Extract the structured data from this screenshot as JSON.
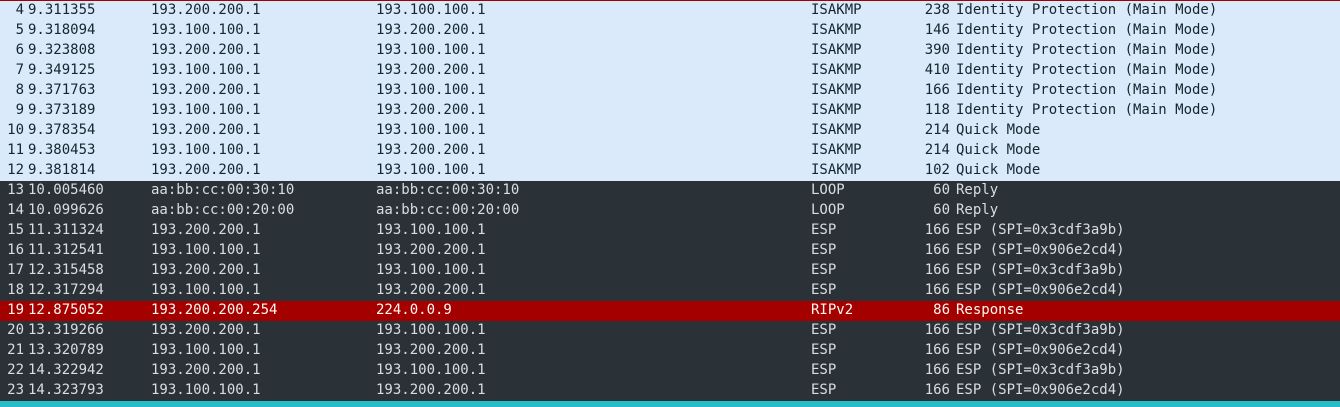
{
  "packet_list": {
    "rows": [
      {
        "no": "4",
        "time": "9.311355",
        "source": "193.200.200.1",
        "destination": "193.100.100.1",
        "protocol": "ISAKMP",
        "length": "238",
        "info": "Identity Protection (Main Mode)",
        "style": "isakmp"
      },
      {
        "no": "5",
        "time": "9.318094",
        "source": "193.100.100.1",
        "destination": "193.200.200.1",
        "protocol": "ISAKMP",
        "length": "146",
        "info": "Identity Protection (Main Mode)",
        "style": "isakmp"
      },
      {
        "no": "6",
        "time": "9.323808",
        "source": "193.200.200.1",
        "destination": "193.100.100.1",
        "protocol": "ISAKMP",
        "length": "390",
        "info": "Identity Protection (Main Mode)",
        "style": "isakmp"
      },
      {
        "no": "7",
        "time": "9.349125",
        "source": "193.100.100.1",
        "destination": "193.200.200.1",
        "protocol": "ISAKMP",
        "length": "410",
        "info": "Identity Protection (Main Mode)",
        "style": "isakmp"
      },
      {
        "no": "8",
        "time": "9.371763",
        "source": "193.200.200.1",
        "destination": "193.100.100.1",
        "protocol": "ISAKMP",
        "length": "166",
        "info": "Identity Protection (Main Mode)",
        "style": "isakmp"
      },
      {
        "no": "9",
        "time": "9.373189",
        "source": "193.100.100.1",
        "destination": "193.200.200.1",
        "protocol": "ISAKMP",
        "length": "118",
        "info": "Identity Protection (Main Mode)",
        "style": "isakmp"
      },
      {
        "no": "10",
        "time": "9.378354",
        "source": "193.200.200.1",
        "destination": "193.100.100.1",
        "protocol": "ISAKMP",
        "length": "214",
        "info": "Quick Mode",
        "style": "isakmp"
      },
      {
        "no": "11",
        "time": "9.380453",
        "source": "193.100.100.1",
        "destination": "193.200.200.1",
        "protocol": "ISAKMP",
        "length": "214",
        "info": "Quick Mode",
        "style": "isakmp"
      },
      {
        "no": "12",
        "time": "9.381814",
        "source": "193.200.200.1",
        "destination": "193.100.100.1",
        "protocol": "ISAKMP",
        "length": "102",
        "info": "Quick Mode",
        "style": "isakmp"
      },
      {
        "no": "13",
        "time": "10.005460",
        "source": "aa:bb:cc:00:30:10",
        "destination": "aa:bb:cc:00:30:10",
        "protocol": "LOOP",
        "length": "60",
        "info": "Reply",
        "style": "dark"
      },
      {
        "no": "14",
        "time": "10.099626",
        "source": "aa:bb:cc:00:20:00",
        "destination": "aa:bb:cc:00:20:00",
        "protocol": "LOOP",
        "length": "60",
        "info": "Reply",
        "style": "dark"
      },
      {
        "no": "15",
        "time": "11.311324",
        "source": "193.200.200.1",
        "destination": "193.100.100.1",
        "protocol": "ESP",
        "length": "166",
        "info": "ESP (SPI=0x3cdf3a9b)",
        "style": "dark"
      },
      {
        "no": "16",
        "time": "11.312541",
        "source": "193.100.100.1",
        "destination": "193.200.200.1",
        "protocol": "ESP",
        "length": "166",
        "info": "ESP (SPI=0x906e2cd4)",
        "style": "dark"
      },
      {
        "no": "17",
        "time": "12.315458",
        "source": "193.200.200.1",
        "destination": "193.100.100.1",
        "protocol": "ESP",
        "length": "166",
        "info": "ESP (SPI=0x3cdf3a9b)",
        "style": "dark"
      },
      {
        "no": "18",
        "time": "12.317294",
        "source": "193.100.100.1",
        "destination": "193.200.200.1",
        "protocol": "ESP",
        "length": "166",
        "info": "ESP (SPI=0x906e2cd4)",
        "style": "dark"
      },
      {
        "no": "19",
        "time": "12.875052",
        "source": "193.200.200.254",
        "destination": "224.0.0.9",
        "protocol": "RIPv2",
        "length": "86",
        "info": "Response",
        "style": "rip"
      },
      {
        "no": "20",
        "time": "13.319266",
        "source": "193.200.200.1",
        "destination": "193.100.100.1",
        "protocol": "ESP",
        "length": "166",
        "info": "ESP (SPI=0x3cdf3a9b)",
        "style": "dark"
      },
      {
        "no": "21",
        "time": "13.320789",
        "source": "193.100.100.1",
        "destination": "193.200.200.1",
        "protocol": "ESP",
        "length": "166",
        "info": "ESP (SPI=0x906e2cd4)",
        "style": "dark"
      },
      {
        "no": "22",
        "time": "14.322942",
        "source": "193.200.200.1",
        "destination": "193.100.100.1",
        "protocol": "ESP",
        "length": "166",
        "info": "ESP (SPI=0x3cdf3a9b)",
        "style": "dark"
      },
      {
        "no": "23",
        "time": "14.323793",
        "source": "193.100.100.1",
        "destination": "193.200.200.1",
        "protocol": "ESP",
        "length": "166",
        "info": "ESP (SPI=0x906e2cd4)",
        "style": "dark"
      }
    ]
  },
  "colors": {
    "isakmp_row_bg": "#dbeafb",
    "dark_row_bg": "#2b3237",
    "ripv2_row_bg": "#a40000",
    "partial_row_bg": "#26bcc8"
  }
}
